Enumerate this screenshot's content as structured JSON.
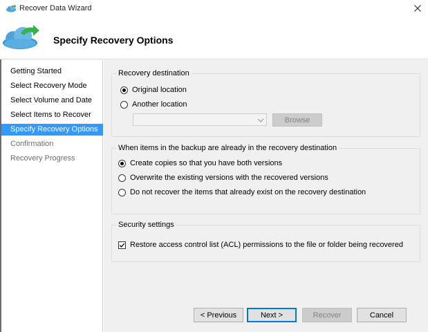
{
  "window": {
    "title": "Recover Data Wizard",
    "heading": "Specify Recovery Options"
  },
  "nav": {
    "items": [
      {
        "label": "Getting Started",
        "state": "normal"
      },
      {
        "label": "Select Recovery Mode",
        "state": "normal"
      },
      {
        "label": "Select Volume and Date",
        "state": "normal"
      },
      {
        "label": "Select Items to Recover",
        "state": "normal"
      },
      {
        "label": "Specify Recovery Options",
        "state": "selected"
      },
      {
        "label": "Confirmation",
        "state": "disabled"
      },
      {
        "label": "Recovery Progress",
        "state": "disabled"
      }
    ]
  },
  "recovery_destination": {
    "legend": "Recovery destination",
    "original_label": "Original location",
    "another_label": "Another location",
    "selected": "original",
    "path_value": "",
    "browse_label": "Browse"
  },
  "conflict": {
    "legend": "When items in the backup are already in the recovery destination",
    "options": [
      "Create copies so that you have both versions",
      "Overwrite the existing versions with the recovered versions",
      "Do not recover the items that already exist on the recovery destination"
    ],
    "selected_index": 0
  },
  "security": {
    "legend": "Security settings",
    "acl_label": "Restore access control list (ACL) permissions to the file or folder being recovered",
    "acl_checked": true
  },
  "buttons": {
    "previous": "< Previous",
    "next": "Next >",
    "recover": "Recover",
    "cancel": "Cancel"
  },
  "colors": {
    "selection": "#3399ff",
    "content_bg": "#f0f0f0",
    "default_button_border": "#0078d7",
    "cloud": "#4fa3d9",
    "arrow": "#37b24d"
  },
  "icons": {
    "app": "cloud-arrow-icon",
    "close": "close-icon",
    "header": "cloud-recover-icon",
    "combo": "chevron-down-icon"
  }
}
